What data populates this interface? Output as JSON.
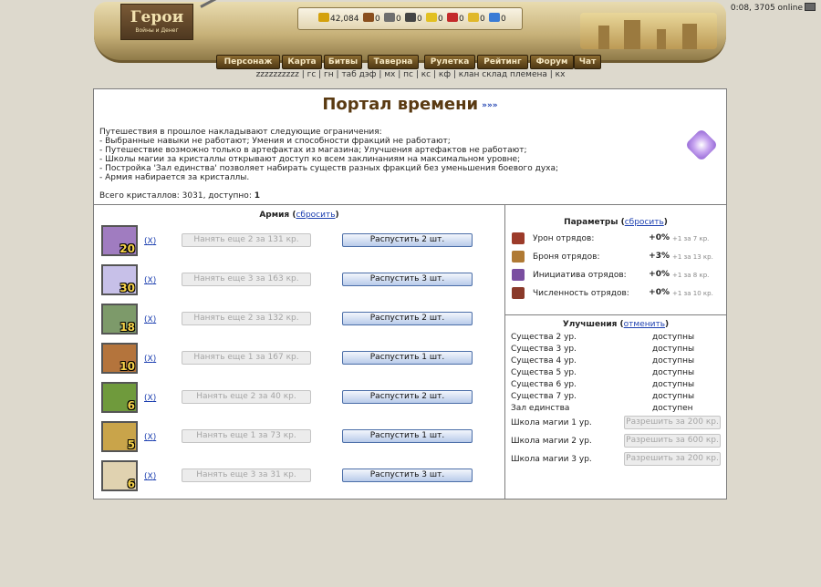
{
  "header": {
    "logo_title": "Герои",
    "logo_subtitle": "Войны и Денег",
    "online_text": "0:08, 3705 online",
    "resources": [
      {
        "icon": "gold-icon",
        "value": "42,084",
        "color": "#d4a10c"
      },
      {
        "icon": "wood-icon",
        "value": "0",
        "color": "#8a4f1e"
      },
      {
        "icon": "ore-icon",
        "value": "0",
        "color": "#6f6f6f"
      },
      {
        "icon": "mercury-icon",
        "value": "0",
        "color": "#444444"
      },
      {
        "icon": "sulfur-icon",
        "value": "0",
        "color": "#e2c022"
      },
      {
        "icon": "crystal-icon",
        "value": "0",
        "color": "#c42a2a"
      },
      {
        "icon": "gem-icon",
        "value": "0",
        "color": "#e0b82a"
      },
      {
        "icon": "diamond-icon",
        "value": "0",
        "color": "#3a7bd5"
      }
    ],
    "nav": [
      "Персонаж",
      "Карта",
      "Битвы",
      "Таверна",
      "Рулетка",
      "Рейтинг",
      "Форум",
      "Чат"
    ],
    "links": [
      "zzzzzzzzzz",
      "гс",
      "гн",
      "таб дэф",
      "мх",
      "пс",
      "кс",
      "кф",
      "клан склад племена",
      "кх"
    ]
  },
  "portal": {
    "title": "Портал времени",
    "title_link": "»»»",
    "intro": "Путешествия в прошлое накладывают следующие ограничения:",
    "rules": [
      "- Выбранные навыки не работают; Умения и способности фракций не работают;",
      "- Путешествие возможно только в артефактах из магазина; Улучшения артефактов не работают;",
      "- Школы магии за кристаллы открывают доступ ко всем заклинаниям на максимальном уровне;",
      "- Постройка 'Зал единства' позволяет набирать существ разных фракций без уменьшения боевого духа;",
      "- Армия набирается за кристаллы."
    ],
    "total_label": "Всего кристаллов: 3031, доступно: ",
    "available": "1"
  },
  "army": {
    "title": "Армия",
    "reset_label": "сбросить",
    "x_label": "X",
    "units": [
      {
        "count": "20",
        "hire": "Нанять еще 2 за 131 кр.",
        "dismiss": "Распустить 2 шт.",
        "color": "#a07cc0"
      },
      {
        "count": "30",
        "hire": "Нанять еще 3 за 163 кр.",
        "dismiss": "Распустить 3 шт.",
        "color": "#c7c0e8"
      },
      {
        "count": "18",
        "hire": "Нанять еще 2 за 132 кр.",
        "dismiss": "Распустить 2 шт.",
        "color": "#7d9a6a"
      },
      {
        "count": "10",
        "hire": "Нанять еще 1 за 167 кр.",
        "dismiss": "Распустить 1 шт.",
        "color": "#b4743c"
      },
      {
        "count": "6",
        "hire": "Нанять еще 2 за 40 кр.",
        "dismiss": "Распустить 2 шт.",
        "color": "#6f9a3c"
      },
      {
        "count": "5",
        "hire": "Нанять еще 1 за 73 кр.",
        "dismiss": "Распустить 1 шт.",
        "color": "#c9a44a"
      },
      {
        "count": "6",
        "hire": "Нанять еще 3 за 31 кр.",
        "dismiss": "Распустить 3 шт.",
        "color": "#e0d2b0"
      }
    ]
  },
  "params": {
    "title": "Параметры",
    "reset_label": "сбросить",
    "rows": [
      {
        "icon": "sword-icon",
        "label": "Урон отрядов:",
        "value": "+0%",
        "cost": "+1 за 7 кр.",
        "color": "#9c3b2a"
      },
      {
        "icon": "armor-icon",
        "label": "Броня отрядов:",
        "value": "+3%",
        "cost": "+1 за 13 кр.",
        "color": "#b07a34"
      },
      {
        "icon": "initiative-icon",
        "label": "Инициатива отрядов:",
        "value": "+0%",
        "cost": "+1 за 8 кр.",
        "color": "#7a4ea0"
      },
      {
        "icon": "army-size-icon",
        "label": "Численность отрядов:",
        "value": "+0%",
        "cost": "+1 за 10 кр.",
        "color": "#8a3a2a"
      }
    ]
  },
  "upgrades": {
    "title": "Улучшения",
    "cancel_label": "отменить",
    "rows": [
      {
        "label": "Существа 2 ур.",
        "status": "доступны"
      },
      {
        "label": "Существа 3 ур.",
        "status": "доступны"
      },
      {
        "label": "Существа 4 ур.",
        "status": "доступны"
      },
      {
        "label": "Существа 5 ур.",
        "status": "доступны"
      },
      {
        "label": "Существа 6 ур.",
        "status": "доступны"
      },
      {
        "label": "Существа 7 ур.",
        "status": "доступны"
      },
      {
        "label": "Зал единства",
        "status": "доступен"
      }
    ],
    "magic": [
      {
        "label": "Школа магии 1 ур.",
        "button": "Разрешить за 200 кр."
      },
      {
        "label": "Школа магии 2 ур.",
        "button": "Разрешить за 600 кр."
      },
      {
        "label": "Школа магии 3 ур.",
        "button": "Разрешить за 200 кр."
      }
    ]
  }
}
